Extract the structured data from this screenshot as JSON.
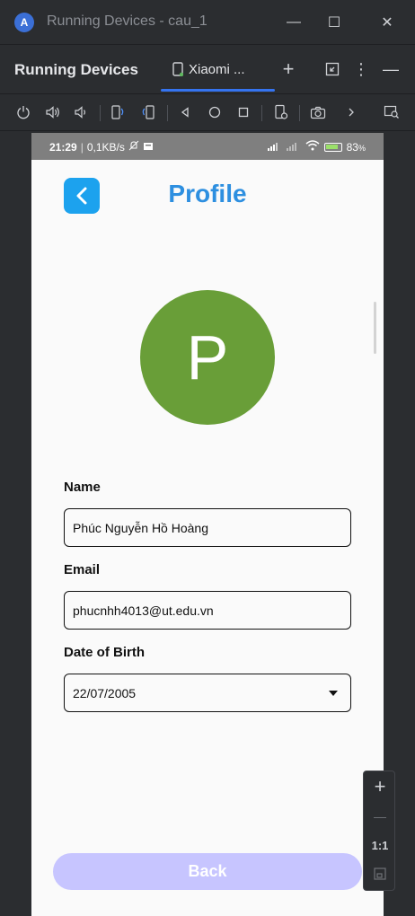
{
  "window": {
    "title": "Running Devices - cau_1",
    "app_icon": "android-studio-icon",
    "minimize_glyph": "—",
    "maximize_glyph": "☐",
    "close_glyph": "✕"
  },
  "tool_window": {
    "title": "Running Devices",
    "device_tab_label": "Xiaomi ...",
    "add_glyph": "+",
    "more_glyph": "⋮",
    "hide_glyph": "—"
  },
  "toolbar": {
    "icons": [
      "power-icon",
      "volume-up-icon",
      "volume-down-icon",
      "rotate-left-icon",
      "rotate-right-icon",
      "back-nav-icon",
      "home-nav-icon",
      "overview-nav-icon",
      "device-settings-icon",
      "screenshot-icon",
      "more-chevron-icon",
      "device-explorer-icon"
    ]
  },
  "status_bar": {
    "time": "21:29",
    "speed": "0,1KB/s",
    "battery": "83"
  },
  "app": {
    "title": "Profile",
    "back_arrow": "‹",
    "avatar_letter": "P",
    "name_label": "Name",
    "name_value": "Phúc Nguyễn Hồ Hoàng",
    "email_label": "Email",
    "email_value": "phucnhh4013@ut.edu.vn",
    "dob_label": "Date of Birth",
    "dob_value": "22/07/2005",
    "back_button_label": "Back"
  },
  "zoom_panel": {
    "zoom_in": "+",
    "zoom_out": "—",
    "actual_size": "1:1"
  },
  "colors": {
    "accent": "#1ca2ee",
    "title": "#2d8fe0",
    "avatar": "#699e38",
    "back_button": "#c7c5ff",
    "tab_underline": "#3574f0"
  }
}
